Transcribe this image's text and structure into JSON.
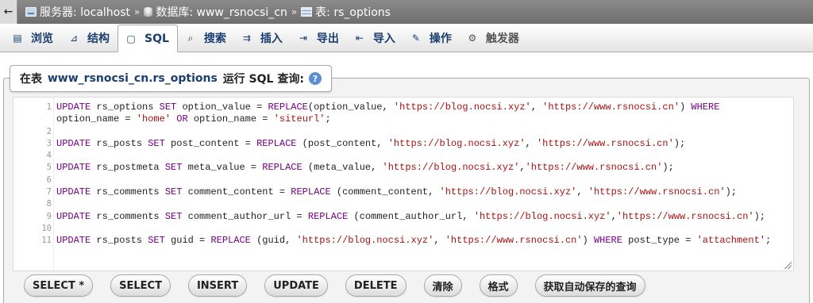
{
  "breadcrumb": {
    "back_icon": "←",
    "server_label": "服务器: localhost",
    "database_label": "数据库: www_rsnocsi_cn",
    "table_label": "表: rs_options",
    "separator": "»"
  },
  "tabs": [
    {
      "label": "浏览",
      "icon": "browse-icon",
      "glyph": "▤"
    },
    {
      "label": "结构",
      "icon": "structure-icon",
      "glyph": "⊿"
    },
    {
      "label": "SQL",
      "icon": "sql-icon",
      "glyph": "▢",
      "active": true
    },
    {
      "label": "搜索",
      "icon": "search-icon",
      "glyph": "⌕"
    },
    {
      "label": "插入",
      "icon": "insert-icon",
      "glyph": "⇉"
    },
    {
      "label": "导出",
      "icon": "export-icon",
      "glyph": "⇥"
    },
    {
      "label": "导入",
      "icon": "import-icon",
      "glyph": "⇤"
    },
    {
      "label": "操作",
      "icon": "operations-icon",
      "glyph": "✎"
    },
    {
      "label": "触发器",
      "icon": "triggers-icon",
      "glyph": "⚙",
      "disabled": true
    }
  ],
  "legend": {
    "prefix": "在表",
    "table": "www_rsnocsi_cn.rs_options",
    "suffix": "运行 SQL 查询:",
    "help_icon": "?"
  },
  "editor": {
    "line_numbers": [
      "1",
      "",
      "2",
      "3",
      "4",
      "5",
      "6",
      "7",
      "8",
      "9",
      "10",
      "11"
    ],
    "lines": [
      "UPDATE rs_options SET option_value = REPLACE(option_value, 'https://blog.nocsi.xyz', 'https://www.rsnocsi.cn') WHERE",
      "option_name = 'home' OR option_name = 'siteurl';",
      "",
      "UPDATE rs_posts SET post_content = REPLACE (post_content, 'https://blog.nocsi.xyz', 'https://www.rsnocsi.cn');",
      "",
      "UPDATE rs_postmeta SET meta_value = REPLACE (meta_value, 'https://blog.nocsi.xyz','https://www.rsnocsi.cn');",
      "",
      "UPDATE rs_comments SET comment_content = REPLACE (comment_content, 'https://blog.nocsi.xyz', 'https://www.rsnocsi.cn');",
      "",
      "UPDATE rs_comments SET comment_author_url = REPLACE (comment_author_url, 'https://blog.nocsi.xyz','https://www.rsnocsi.cn');",
      "",
      "UPDATE rs_posts SET guid = REPLACE (guid, 'https://blog.nocsi.xyz', 'https://www.rsnocsi.cn') WHERE post_type = 'attachment';"
    ]
  },
  "buttons": [
    {
      "name": "select-star-button",
      "label": "SELECT *"
    },
    {
      "name": "select-button",
      "label": "SELECT"
    },
    {
      "name": "insert-button",
      "label": "INSERT"
    },
    {
      "name": "update-button",
      "label": "UPDATE"
    },
    {
      "name": "delete-button",
      "label": "DELETE"
    },
    {
      "name": "clear-button",
      "label": "清除"
    },
    {
      "name": "format-button",
      "label": "格式"
    },
    {
      "name": "get-autosaved-query-button",
      "label": "获取自动保存的查询"
    }
  ],
  "colors": {
    "keyword": "#770088",
    "string": "#aa1111",
    "tab_text": "#1a3e72"
  }
}
